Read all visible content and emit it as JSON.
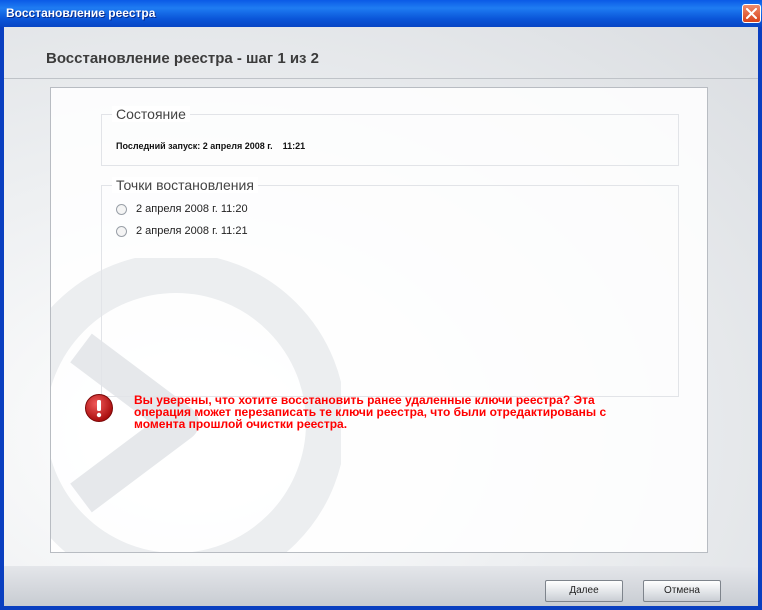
{
  "window": {
    "title": "Восстановление реестра",
    "close_icon": "close-icon"
  },
  "wizard": {
    "heading": "Восстановление реестра - шаг 1 из 2"
  },
  "status_group": {
    "legend": "Состояние",
    "last_run_label": "Последний запуск:",
    "last_run_date": "2 апреля 2008 г.",
    "last_run_time": "11:21"
  },
  "restore_points": {
    "legend": "Точки востановления",
    "items": [
      {
        "label": "2 апреля 2008 г. 11:20",
        "selected": false
      },
      {
        "label": "2 апреля 2008 г. 11:21",
        "selected": false
      }
    ]
  },
  "warning": {
    "icon": "exclamation-icon",
    "text": "Вы уверены, что хотите восстановить ранее удаленные ключи реестра? Эта операция может перезаписать те ключи реестра, что были отредактированы с момента прошлой очистки реестра."
  },
  "buttons": {
    "next": "Далее",
    "cancel": "Отмена"
  },
  "colors": {
    "title_bar": "#0a55d8",
    "warning_text": "#ff0000",
    "warning_icon": "#c81414"
  }
}
